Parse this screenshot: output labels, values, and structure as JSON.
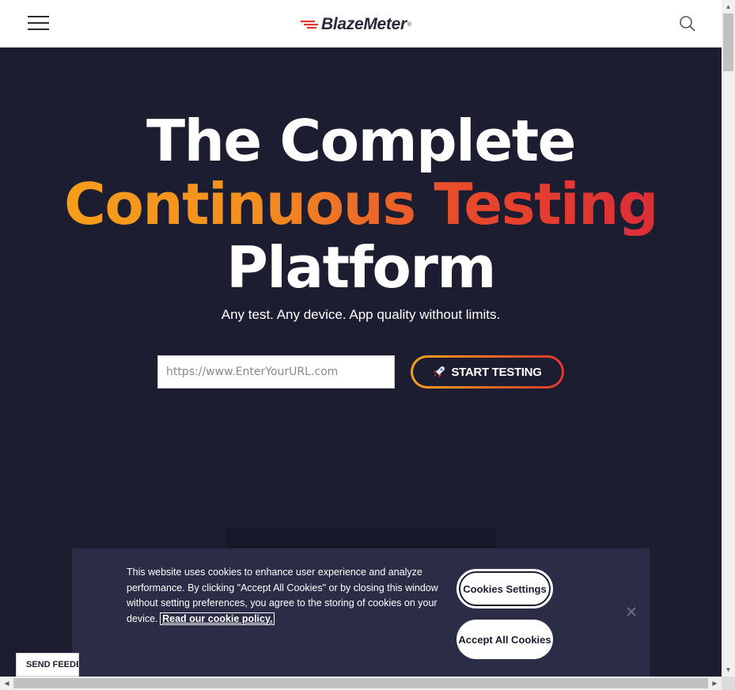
{
  "header": {
    "logo_text": "BlazeMeter",
    "logo_reg": "®",
    "menu_icon": "hamburger-menu-icon",
    "search_icon": "search-icon"
  },
  "hero": {
    "headline_line1": "The Complete",
    "headline_line2": "Continuous Testing",
    "headline_line3": "Platform",
    "subtitle": "Any test. Any device. App quality without limits.",
    "url_placeholder": "https://www.EnterYourURL.com",
    "start_button_label": "START TESTING",
    "start_button_icon": "rocket-icon"
  },
  "cookie_banner": {
    "text": "This website uses cookies to enhance user experience and analyze performance. By clicking \"Accept All Cookies\" or by closing this window without setting preferences, you agree to the storing of cookies on your device.",
    "policy_link": "Read our cookie policy.",
    "settings_button": "Cookies Settings",
    "accept_button": "Accept All Cookies",
    "close_icon": "close-icon"
  },
  "feedback": {
    "label": "SEND FEEDBACK"
  },
  "colors": {
    "hero_bg": "#1c1d31",
    "accent_orange": "#f7a21b",
    "accent_red": "#d8243a",
    "banner_bg": "#2b2c45"
  }
}
